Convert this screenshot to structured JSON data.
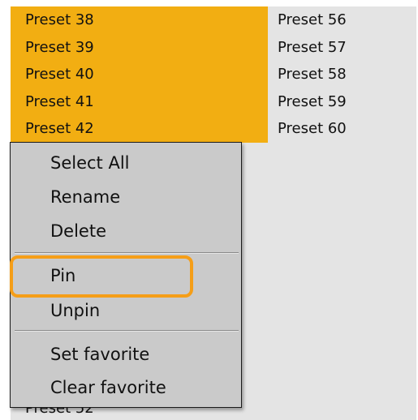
{
  "presets_left": [
    "Preset 38",
    "Preset 39",
    "Preset 40",
    "Preset 41",
    "Preset 42"
  ],
  "presets_right": [
    "Preset 56",
    "Preset 57",
    "Preset 58",
    "Preset 59",
    "Preset 60"
  ],
  "occluded_row_label": "Preset 52",
  "context_menu": {
    "select_all": "Select All",
    "rename": "Rename",
    "delete": "Delete",
    "pin": "Pin",
    "unpin": "Unpin",
    "set_favorite": "Set favorite",
    "clear_favorite": "Clear favorite"
  },
  "colors": {
    "selection": "#f2ae12",
    "highlight_ring": "#f59e18",
    "menu_bg": "#cacaca",
    "list_bg": "#e4e4e4"
  }
}
